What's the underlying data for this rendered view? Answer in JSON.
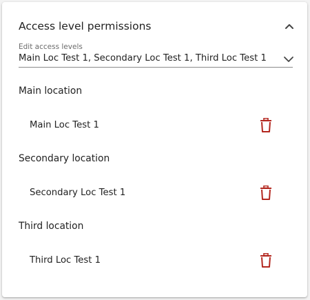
{
  "panel": {
    "title": "Access level permissions",
    "collapse_icon": "chevron-up-icon"
  },
  "access_select": {
    "label": "Edit access levels",
    "value": "Main Loc Test 1, Secondary Loc Test 1, Third Loc Test 1",
    "chevron_icon": "chevron-down-icon"
  },
  "sections": [
    {
      "title": "Main location",
      "item": "Main Loc Test 1",
      "delete_icon": "trash-icon"
    },
    {
      "title": "Secondary location",
      "item": "Secondary Loc Test 1",
      "delete_icon": "trash-icon"
    },
    {
      "title": "Third location",
      "item": "Third Loc Test 1",
      "delete_icon": "trash-icon"
    }
  ],
  "colors": {
    "delete_icon": "#b3261e",
    "text": "#222222",
    "label": "#6b6b6b"
  }
}
